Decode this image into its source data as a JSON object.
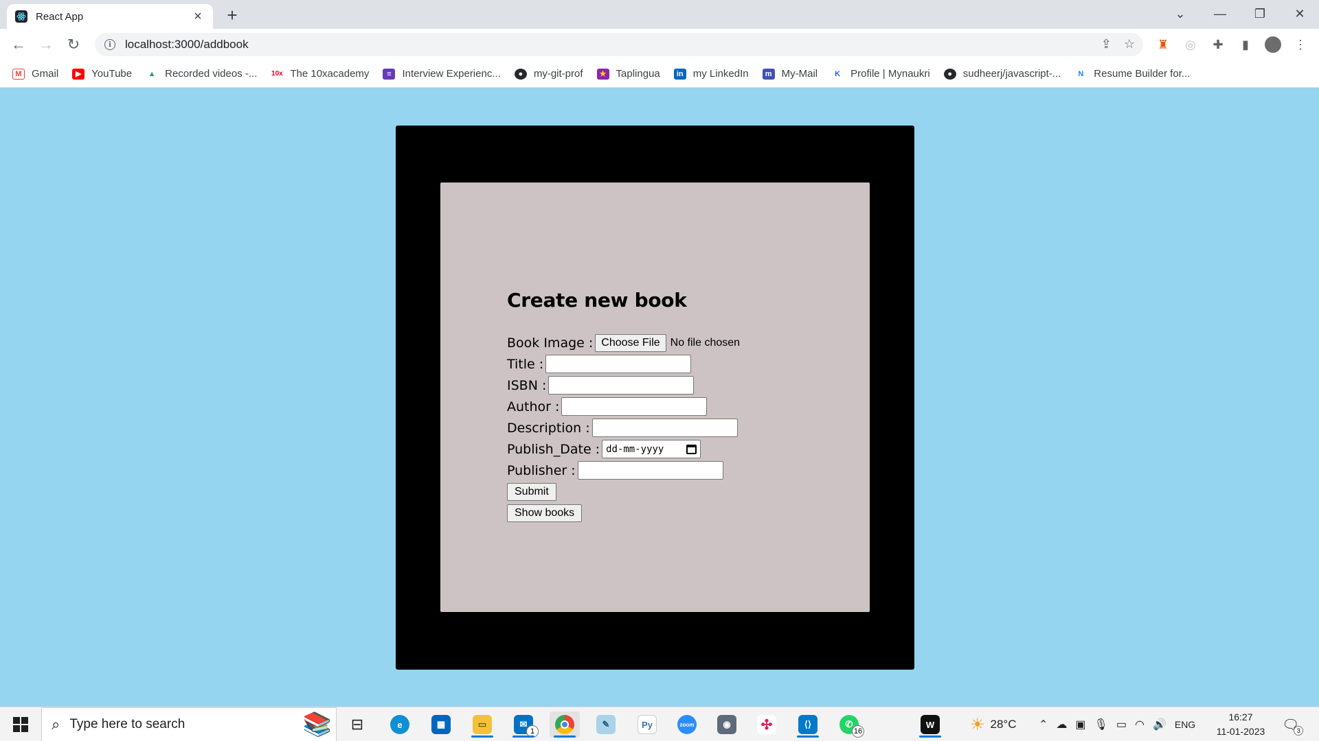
{
  "browser": {
    "tab_title": "React App",
    "url": "localhost:3000/addbook",
    "bookmarks": [
      {
        "label": "Gmail",
        "icon": "gmail-icon",
        "color": "#ea4335"
      },
      {
        "label": "YouTube",
        "icon": "youtube-icon",
        "color": "#ff0000"
      },
      {
        "label": "Recorded videos -...",
        "icon": "google-drive-icon",
        "color": "#1fa463"
      },
      {
        "label": "The 10xacademy",
        "icon": "10x-icon",
        "color": "#e4002b"
      },
      {
        "label": "Interview Experienc...",
        "icon": "forms-icon",
        "color": "#673ab7"
      },
      {
        "label": "my-git-prof",
        "icon": "github-icon",
        "color": "#24292e"
      },
      {
        "label": "Taplingua",
        "icon": "taplingua-icon",
        "color": "#8e24aa"
      },
      {
        "label": "my LinkedIn",
        "icon": "linkedin-icon",
        "color": "#0a66c2"
      },
      {
        "label": "My-Mail",
        "icon": "mail-m-icon",
        "color": "#3f51b5"
      },
      {
        "label": "Profile | Mynaukri",
        "icon": "naukri-icon",
        "color": "#275df5"
      },
      {
        "label": "sudheerj/javascript-...",
        "icon": "github-icon",
        "color": "#24292e"
      },
      {
        "label": "Resume Builder for...",
        "icon": "novoresume-icon",
        "color": "#1e88e5"
      }
    ]
  },
  "form": {
    "heading": "Create new book",
    "book_image_label": "Book Image :",
    "choose_file_label": "Choose File",
    "no_file_text": "No file chosen",
    "title_label": "Title :",
    "isbn_label": "ISBN :",
    "author_label": "Author :",
    "description_label": "Description :",
    "publish_date_label": "Publish_Date :",
    "publish_date_placeholder": "dd-mm-yyyy",
    "publisher_label": "Publisher :",
    "submit_label": "Submit",
    "show_books_label": "Show books"
  },
  "taskbar": {
    "search_placeholder": "Type here to search",
    "weather": "28°C",
    "language": "ENG",
    "time": "16:27",
    "date": "11-01-2023",
    "mail_badge": "1",
    "whatsapp_badge": "16",
    "notification_badge": "3"
  },
  "colors": {
    "page_background": "#95d5f0",
    "outer_box": "#000000",
    "inner_box": "#cdc3c4"
  }
}
